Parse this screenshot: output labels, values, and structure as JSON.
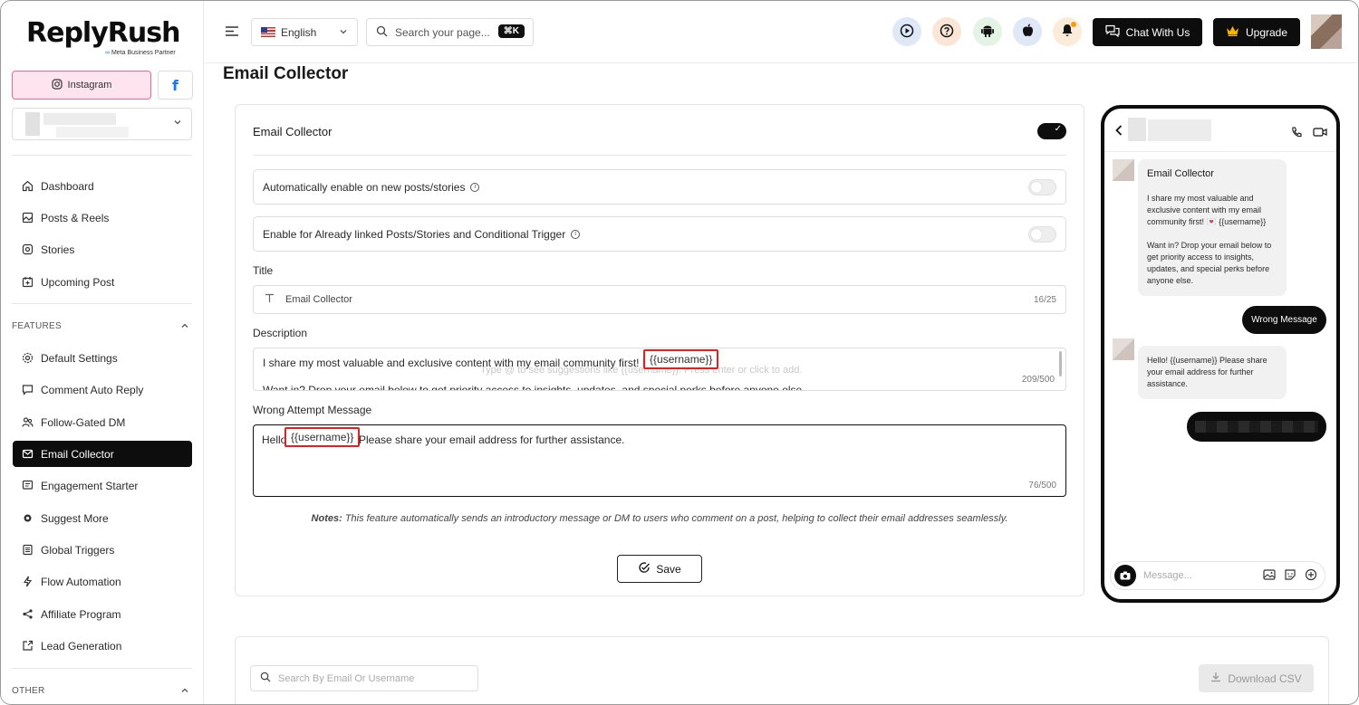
{
  "brand": {
    "name": "ReplyRush",
    "partner_badge": "Meta Business Partner"
  },
  "platforms": {
    "instagram_label": "Instagram",
    "facebook_label": "f"
  },
  "sidebar": {
    "main_items": [
      {
        "label": "Dashboard",
        "icon": "home-icon"
      },
      {
        "label": "Posts & Reels",
        "icon": "image-icon"
      },
      {
        "label": "Stories",
        "icon": "stories-icon"
      },
      {
        "label": "Upcoming Post",
        "icon": "calendar-plus-icon"
      }
    ],
    "features_label": "FEATURES",
    "feature_items": [
      {
        "label": "Default Settings",
        "icon": "gear-icon"
      },
      {
        "label": "Comment Auto Reply",
        "icon": "comment-icon"
      },
      {
        "label": "Follow-Gated DM",
        "icon": "users-icon"
      },
      {
        "label": "Email Collector",
        "icon": "email-icon",
        "active": true
      },
      {
        "label": "Engagement Starter",
        "icon": "message-lines-icon"
      },
      {
        "label": "Suggest More",
        "icon": "sparkle-gear-icon"
      },
      {
        "label": "Global Triggers",
        "icon": "list-icon"
      },
      {
        "label": "Flow Automation",
        "icon": "bolt-icon"
      },
      {
        "label": "Affiliate Program",
        "icon": "share-icon"
      },
      {
        "label": "Lead Generation",
        "icon": "external-square-icon"
      }
    ],
    "other_label": "OTHER"
  },
  "topbar": {
    "language": "English",
    "search_placeholder": "Search your page...",
    "shortcut": "⌘K",
    "chat_label": "Chat With Us",
    "upgrade_label": "Upgrade"
  },
  "page": {
    "title": "Email Collector"
  },
  "card": {
    "title": "Email Collector",
    "enabled": true,
    "option_auto_enable": "Automatically enable on new posts/stories",
    "option_linked": "Enable for Already linked Posts/Stories and Conditional Trigger",
    "title_label": "Title",
    "title_value": "Email Collector",
    "title_counter": "16/25",
    "description_label": "Description",
    "description_line1": "I share my most valuable and exclusive content with my email community first! 💌",
    "description_variable": "{{username}}",
    "description_line2": "Want in? Drop your email below to get priority access to insights, updates, and special perks before anyone else.",
    "description_hint": "Type @ to see suggestions like {{username}}. Press enter or click to add.",
    "description_counter": "209/500",
    "wrong_label": "Wrong Attempt Message",
    "wrong_prefix": "Hello!",
    "wrong_variable": "{{username}}",
    "wrong_suffix": "Please share your email address for further assistance.",
    "wrong_counter": "76/500",
    "notes_prefix": "Notes:",
    "notes_text": " This feature automatically sends an introductory message or DM to users who comment on a post, helping to collect their email addresses seamlessly.",
    "save_label": "Save"
  },
  "preview": {
    "bubble1_title": "Email Collector",
    "bubble1_p1": "I share my most valuable and exclusive content with my email community first! 💌 {{username}}",
    "bubble1_p2": "Want in? Drop your email below to get priority access to insights, updates, and special perks before anyone else.",
    "wrong_message_label": "Wrong Message",
    "bubble2": "Hello! {{username}} Please share your email address for further assistance.",
    "input_placeholder": "Message..."
  },
  "table": {
    "search_placeholder": "Search By Email Or Username",
    "download_label": "Download CSV"
  },
  "colors": {
    "accent": "#0d0d0d",
    "instagram_bg": "#fde4ee",
    "instagram_border": "#e86a94",
    "facebook": "#1877f2",
    "highlight_red": "#e32020"
  }
}
